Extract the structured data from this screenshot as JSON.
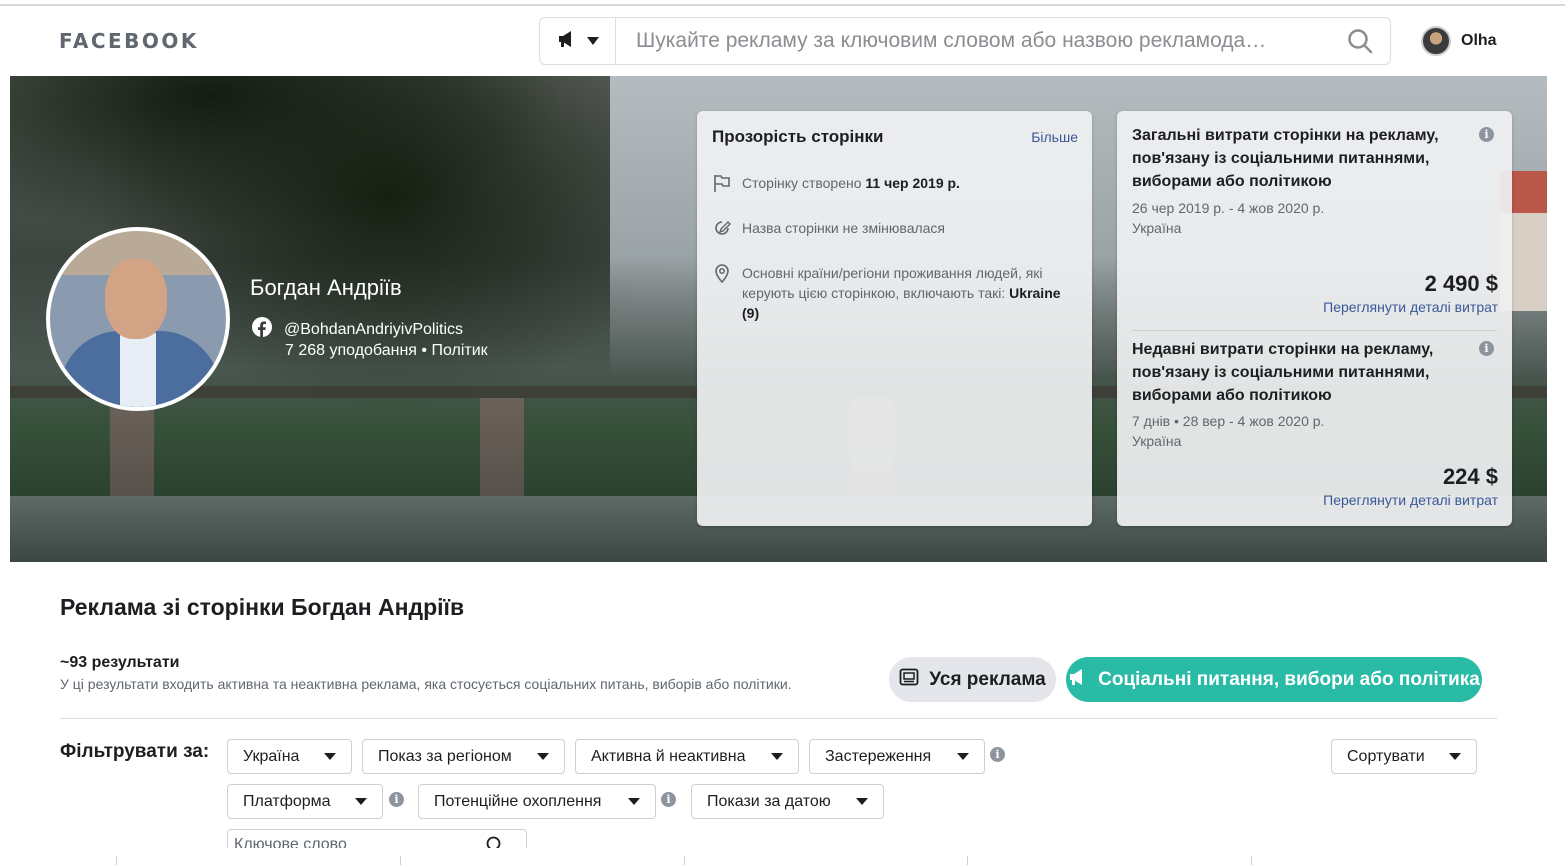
{
  "header": {
    "logo": "FACEBOOK",
    "search_placeholder": "Шукайте рекламу за ключовим словом або назвою рекламода…",
    "user_name": "Olha"
  },
  "page": {
    "name": "Богдан Андріїв",
    "handle": "@BohdanAndriyivPolitics",
    "stats": "7 268 уподобання • Політик"
  },
  "transparency": {
    "title": "Прозорість сторінки",
    "more": "Більше",
    "created_prefix": "Сторінку створено",
    "created_date": "11 чер 2019 р.",
    "name_unchanged": "Назва сторінки не змінювалася",
    "countries_text": "Основні країни/регіони проживання людей, які керують цією сторінкою, включають такі:",
    "countries_value": "Ukraine (9)"
  },
  "spend": {
    "total": {
      "title": "Загальні витрати сторінки на рекламу, пов'язану із соціальними питаннями, виборами або політикою",
      "period": "26 чер 2019 р. - 4 жов 2020 р.",
      "region": "Україна",
      "amount": "2 490 $",
      "link": "Переглянути деталі витрат"
    },
    "recent": {
      "title": "Недавні витрати сторінки на рекламу, пов'язану із соціальними питаннями, виборами або політикою",
      "period": "7 днів • 28 вер - 4 жов 2020 р.",
      "region": "Україна",
      "amount": "224 $",
      "link": "Переглянути деталі витрат"
    }
  },
  "section": {
    "title": "Реклама зі сторінки Богдан Андріїв",
    "results": "~93 результати",
    "results_sub": "У ці результати входить активна та неактивна реклама, яка стосується соціальних питань, виборів або політики.",
    "btn_all": "Уся реклама",
    "btn_political": "Соціальні питання, вибори або політика"
  },
  "filters": {
    "label": "Фільтрувати за:",
    "country": "Україна",
    "region": "Показ за регіоном",
    "status": "Активна й неактивна",
    "disclaimer": "Застереження",
    "sort": "Сортувати",
    "platform": "Платформа",
    "reach": "Потенційне охоплення",
    "date": "Покази за датою",
    "keyword_placeholder": "Ключове слово"
  },
  "colors": {
    "accent": "#2abba7",
    "link": "#385898"
  }
}
